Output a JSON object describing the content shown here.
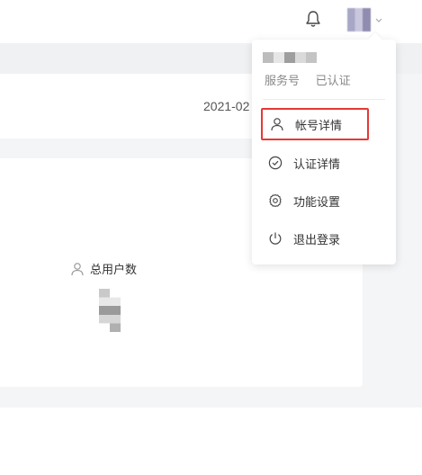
{
  "header": {
    "notification_icon": "bell-icon",
    "avatar_icon": "avatar",
    "caret_icon": "chevron-down-icon"
  },
  "content": {
    "date": "2021-02",
    "stats": {
      "total_users_label": "总用户数",
      "total_users_icon": "user-icon"
    }
  },
  "dropdown": {
    "account_type": "服务号",
    "verification_status": "已认证",
    "items": [
      {
        "label": "帐号详情",
        "icon": "user-icon"
      },
      {
        "label": "认证详情",
        "icon": "check-circle-icon"
      },
      {
        "label": "功能设置",
        "icon": "gear-icon"
      },
      {
        "label": "退出登录",
        "icon": "power-icon"
      }
    ],
    "highlight_color": "#e53935"
  }
}
